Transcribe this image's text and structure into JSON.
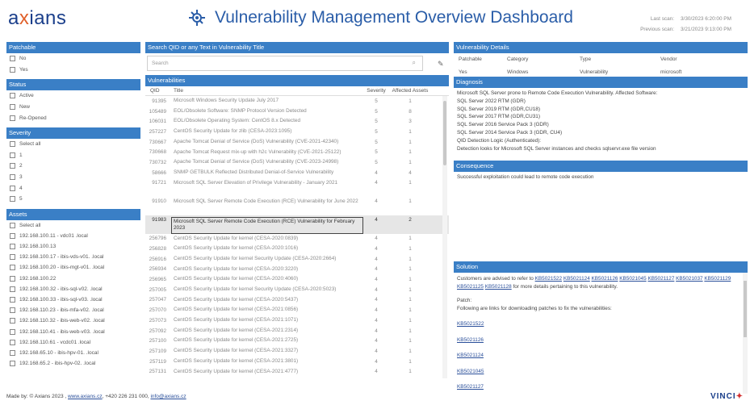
{
  "header": {
    "logo_main": "a",
    "logo_x": "x",
    "logo_rest": "ians",
    "title": "Vulnerability Management Overview Dashboard",
    "last_scan_label": "Last scan:",
    "last_scan_value": "3/30/2023 6:20:00 PM",
    "previous_scan_label": "Previous scan:",
    "previous_scan_value": "3/21/2023 9:13:00 PM"
  },
  "filters": {
    "patchable": {
      "title": "Patchable",
      "items": [
        "No",
        "Yes"
      ]
    },
    "status": {
      "title": "Status",
      "items": [
        "Active",
        "New",
        "Re-Opened"
      ]
    },
    "severity": {
      "title": "Severity",
      "items": [
        "Select all",
        "1",
        "2",
        "3",
        "4",
        "5"
      ]
    },
    "assets": {
      "title": "Assets",
      "items": [
        "Select all",
        "192.168.100.11 - vdc01 .local",
        "192.168.100.13",
        "192.168.100.17 - ibis-vds-v01. .local",
        "192.168.100.20 - ibis-mgt-v01. .local",
        "192.168.100.22",
        "192.168.100.32 - ibis-sql-v02. .local",
        "192.168.100.33 - ibis-sql-v03. .local",
        "192.168.110.23 - ibis-mfa-v02. .local",
        "192.168.110.32 - ibis-web-v02. .local",
        "192.168.110.41 - ibis-web-v03. .local",
        "192.168.110.61 - vcdc01 .local",
        "192.168.65.10 - ibis-hpv-01. .local",
        "192.168.65.2 - ibis-hpv-02. .local"
      ]
    }
  },
  "search": {
    "title": "Search QID or any Text in Vulnerability Title",
    "placeholder": "Search"
  },
  "vulnerabilities": {
    "title": "Vulnerabilities",
    "headers": {
      "qid": "QID",
      "title": "Title",
      "severity": "Severity",
      "affected": "Affected Assets"
    },
    "rows": [
      {
        "qid": "91395",
        "title": "Microsoft Windows Security Update July 2017",
        "severity": "5",
        "affected": "1"
      },
      {
        "qid": "105489",
        "title": "EOL/Obsolete Software: SNMP Protocol Version Detected",
        "severity": "5",
        "affected": "8"
      },
      {
        "qid": "106031",
        "title": "EOL/Obsolete Operating System: CentOS 8.x Detected",
        "severity": "5",
        "affected": "3"
      },
      {
        "qid": "257227",
        "title": "CentOS Security Update for zlib (CESA-2023:1095)",
        "severity": "5",
        "affected": "1"
      },
      {
        "qid": "730667",
        "title": "Apache Tomcat Denial of Service (DoS) Vulnerability (CVE-2021-42340)",
        "severity": "5",
        "affected": "1"
      },
      {
        "qid": "730668",
        "title": "Apache Tomcat Request mix-up with h2c Vulnerability (CVE-2021-25122)",
        "severity": "5",
        "affected": "1"
      },
      {
        "qid": "730732",
        "title": "Apache Tomcat Denial of Service (DoS) Vulnerability (CVE-2023-24998)",
        "severity": "5",
        "affected": "1"
      },
      {
        "qid": "58666",
        "title": "SNMP GETBULK Reflected Distributed Denial-of-Service Vulnerability",
        "severity": "4",
        "affected": "4"
      },
      {
        "qid": "91721",
        "title": "Microsoft SQL Server Elevation of Privilege Vulnerability - January 2021",
        "severity": "4",
        "affected": "1"
      },
      {
        "qid": "91910",
        "title": "Microsoft SQL Server Remote Code Execution (RCE) Vulnerability for June 2022",
        "severity": "4",
        "affected": "1"
      },
      {
        "qid": "91983",
        "title": "Microsoft SQL Server Remote Code Execution (RCE) Vulnerability for February 2023",
        "severity": "4",
        "affected": "2"
      },
      {
        "qid": "256796",
        "title": "CentOS Security Update for kernel (CESA-2020:0839)",
        "severity": "4",
        "affected": "1"
      },
      {
        "qid": "256828",
        "title": "CentOS Security Update for kernel (CESA-2020:1016)",
        "severity": "4",
        "affected": "1"
      },
      {
        "qid": "256916",
        "title": "CentOS Security Update for kernel Security Update (CESA-2020:2664)",
        "severity": "4",
        "affected": "1"
      },
      {
        "qid": "256934",
        "title": "CentOS Security Update for kernel (CESA-2020:3220)",
        "severity": "4",
        "affected": "1"
      },
      {
        "qid": "256965",
        "title": "CentOS Security Update for kernel (CESA-2020:4060)",
        "severity": "4",
        "affected": "1"
      },
      {
        "qid": "257005",
        "title": "CentOS Security Update for kernel Security Update (CESA-2020:5023)",
        "severity": "4",
        "affected": "1"
      },
      {
        "qid": "257047",
        "title": "CentOS Security Update for kernel (CESA-2020:5437)",
        "severity": "4",
        "affected": "1"
      },
      {
        "qid": "257070",
        "title": "CentOS Security Update for kernel (CESA-2021:0856)",
        "severity": "4",
        "affected": "1"
      },
      {
        "qid": "257073",
        "title": "CentOS Security Update for kernel (CESA-2021:1071)",
        "severity": "4",
        "affected": "1"
      },
      {
        "qid": "257092",
        "title": "CentOS Security Update for kernel (CESA-2021:2314)",
        "severity": "4",
        "affected": "1"
      },
      {
        "qid": "257100",
        "title": "CentOS Security Update for kernel (CESA-2021:2725)",
        "severity": "4",
        "affected": "1"
      },
      {
        "qid": "257109",
        "title": "CentOS Security Update for kernel (CESA-2021:3327)",
        "severity": "4",
        "affected": "1"
      },
      {
        "qid": "257119",
        "title": "CentOS Security Update for kernel (CESA-2021:3801)",
        "severity": "4",
        "affected": "1"
      },
      {
        "qid": "257131",
        "title": "CentOS Security Update for kernel (CESA-2021:4777)",
        "severity": "4",
        "affected": "1"
      }
    ]
  },
  "details": {
    "title": "Vulnerability Details",
    "headers": [
      "Patchable",
      "Category",
      "Type",
      "Vendor"
    ],
    "values": [
      "Yes",
      "Windows",
      "Vulnerability",
      "microsoft"
    ]
  },
  "diagnosis": {
    "title": "Diagnosis",
    "lines": [
      "Microsoft SQL Server prone to Remote Code Execution Vulnerability. Affected Software:",
      "SQL Server 2022 RTM (GDR)",
      "SQL Server 2019 RTM (GDR,CU18)",
      "SQL Server 2017 RTM (GDR,CU31)",
      "SQL Server 2016 Service Pack 3 (GDR)",
      "SQL Server 2014 Service Pack 3 (GDR, CU4)",
      "QID Detection Logic (Authenticated):",
      "Detection looks for Microsoft SQL Server instances and checks sqlservr.exe file version"
    ]
  },
  "consequence": {
    "title": "Consequence",
    "text": "Successful exploitation could lead to remote code execution"
  },
  "solution": {
    "title": "Solution",
    "intro": "Customers are advised to refer to",
    "kb_inline": [
      "KB5021522",
      "KB5021124",
      "KB5021126",
      "KB5021045",
      "KB5021127",
      "KB5021037",
      "KB5021129",
      "KB5021125",
      "KB5021128"
    ],
    "outro": "for more details pertaining to this vulnerability.",
    "patch_label": "Patch:",
    "patch_text": "Following are links for downloading patches to fix the vulnerabilities:",
    "kb_links": [
      "KB5021522",
      "KB5021126",
      "KB5021124",
      "KB5021045",
      "KB5021127"
    ]
  },
  "footer": {
    "prefix": "Made by: © Axians 2023 ,",
    "website": "www.axians.cz",
    "phone": ", +420 226 231 000,",
    "email": "info@axians.cz",
    "brand": "VINCI"
  },
  "colors": {
    "section_header": "#3a7fc6",
    "title_blue": "#2a5da8",
    "logo_blue": "#1b3f8b",
    "logo_orange": "#e0602a"
  }
}
